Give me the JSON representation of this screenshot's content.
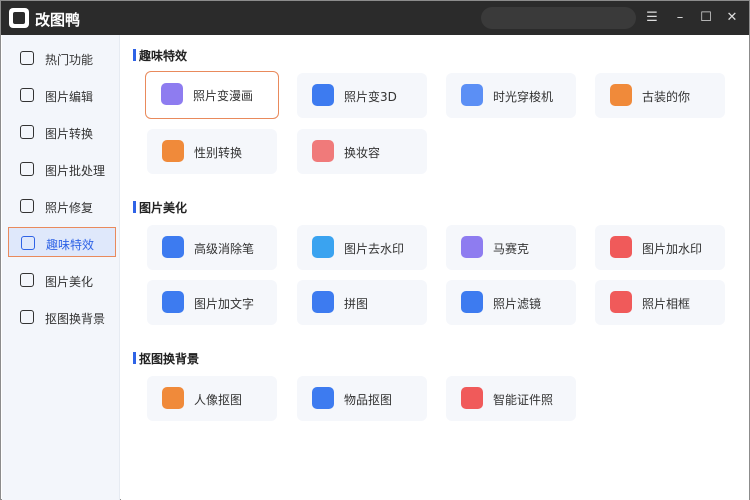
{
  "app": {
    "title": "改图鸭"
  },
  "window_controls": {
    "menu": "☰",
    "minimize": "–",
    "maximize": "☐",
    "close": "✕"
  },
  "sidebar": {
    "active_index": 5,
    "items": [
      {
        "label": "热门功能",
        "icon": "flame-icon"
      },
      {
        "label": "图片编辑",
        "icon": "image-edit-icon"
      },
      {
        "label": "图片转换",
        "icon": "image-convert-icon"
      },
      {
        "label": "图片批处理",
        "icon": "batch-icon"
      },
      {
        "label": "照片修复",
        "icon": "photo-repair-icon"
      },
      {
        "label": "趣味特效",
        "icon": "magic-wand-icon"
      },
      {
        "label": "图片美化",
        "icon": "beautify-icon"
      },
      {
        "label": "抠图换背景",
        "icon": "cutout-icon"
      }
    ]
  },
  "sections": [
    {
      "title": "趣味特效",
      "cards": [
        {
          "label": "照片变漫画",
          "icon": "cartoon-icon",
          "color": "#8e7cf0",
          "selected": true
        },
        {
          "label": "照片变3D",
          "icon": "cube-3d-icon",
          "color": "#3d7bf0"
        },
        {
          "label": "时光穿梭机",
          "icon": "time-machine-icon",
          "color": "#5b8ff5"
        },
        {
          "label": "古装的你",
          "icon": "ancient-costume-icon",
          "color": "#f08a3a"
        },
        {
          "label": "性别转换",
          "icon": "gender-icon",
          "color": "#f08a3a"
        },
        {
          "label": "换妆容",
          "icon": "makeup-icon",
          "color": "#f07a7a"
        }
      ]
    },
    {
      "title": "图片美化",
      "cards": [
        {
          "label": "高级消除笔",
          "icon": "eraser-pen-icon",
          "color": "#3d7bf0"
        },
        {
          "label": "图片去水印",
          "icon": "water-drop-icon",
          "color": "#3aa3f0"
        },
        {
          "label": "马赛克",
          "icon": "mosaic-icon",
          "color": "#8e7cf0"
        },
        {
          "label": "图片加水印",
          "icon": "add-watermark-icon",
          "color": "#f05a5a"
        },
        {
          "label": "图片加文字",
          "icon": "add-text-icon",
          "color": "#3d7bf0"
        },
        {
          "label": "拼图",
          "icon": "collage-icon",
          "color": "#3d7bf0"
        },
        {
          "label": "照片滤镜",
          "icon": "filter-icon",
          "color": "#3d7bf0"
        },
        {
          "label": "照片相框",
          "icon": "frame-icon",
          "color": "#f05a5a"
        }
      ]
    },
    {
      "title": "抠图换背景",
      "cards": [
        {
          "label": "人像抠图",
          "icon": "portrait-cutout-icon",
          "color": "#f08a3a"
        },
        {
          "label": "物品抠图",
          "icon": "object-cutout-icon",
          "color": "#3d7bf0"
        },
        {
          "label": "智能证件照",
          "icon": "id-photo-icon",
          "color": "#f05a5a"
        }
      ]
    }
  ]
}
